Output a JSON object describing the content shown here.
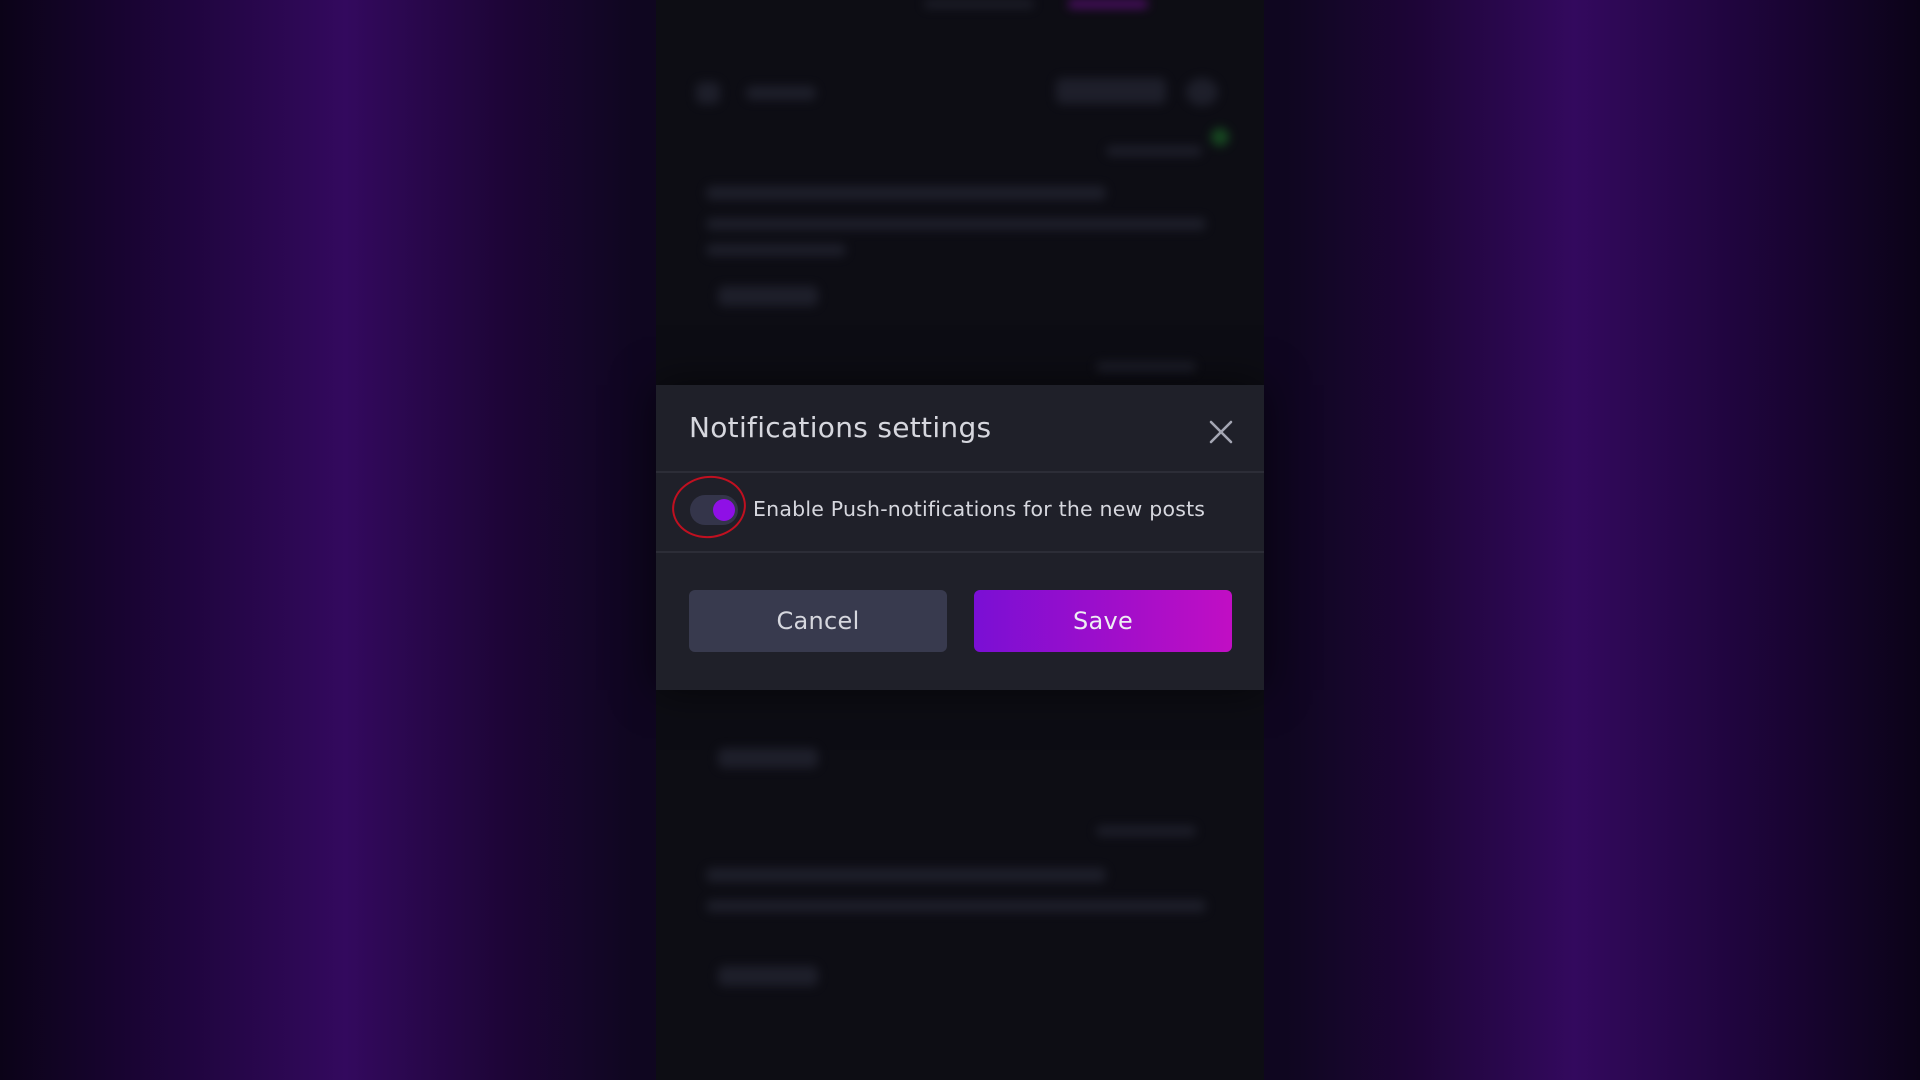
{
  "modal": {
    "title": "Notifications settings",
    "close_icon": "close-icon",
    "toggle": {
      "label": "Enable Push-notifications for the new posts",
      "checked": true,
      "accent_color": "#8f10e6"
    },
    "cancel_label": "Cancel",
    "save_label": "Save",
    "save_color": "#a40ec9"
  }
}
